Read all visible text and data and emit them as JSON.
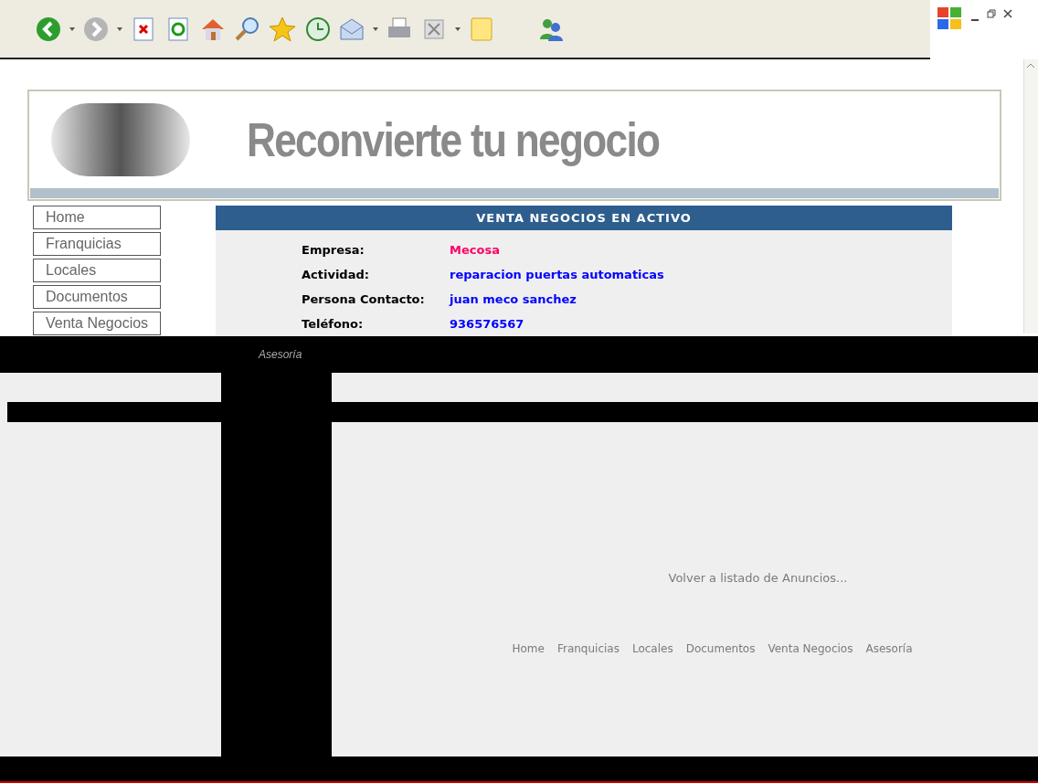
{
  "header": {
    "title": "Reconvierte tu negocio"
  },
  "menu": [
    {
      "label": "Home"
    },
    {
      "label": "Franquicias"
    },
    {
      "label": "Locales"
    },
    {
      "label": "Documentos"
    },
    {
      "label": "Venta Negocios"
    }
  ],
  "panel": {
    "title": "VENTA NEGOCIOS EN ACTIVO",
    "fields": [
      {
        "label": "Empresa:",
        "value": "Mecosa",
        "color": "#ff0066"
      },
      {
        "label": "Actividad:",
        "value": "reparacion puertas automaticas",
        "color": "#0000ff"
      },
      {
        "label": "Persona Contacto:",
        "value": "juan meco sanchez",
        "color": "#0000ff"
      },
      {
        "label": "Teléfono:",
        "value": "936576567",
        "color": "#0000ff"
      }
    ]
  },
  "glitch_label": "Asesoría",
  "back_link": "Volver a listado de Anuncios...",
  "footer_links": [
    "Home",
    "Franquicias",
    "Locales",
    "Documentos",
    "Venta Negocios",
    "Asesoría"
  ]
}
